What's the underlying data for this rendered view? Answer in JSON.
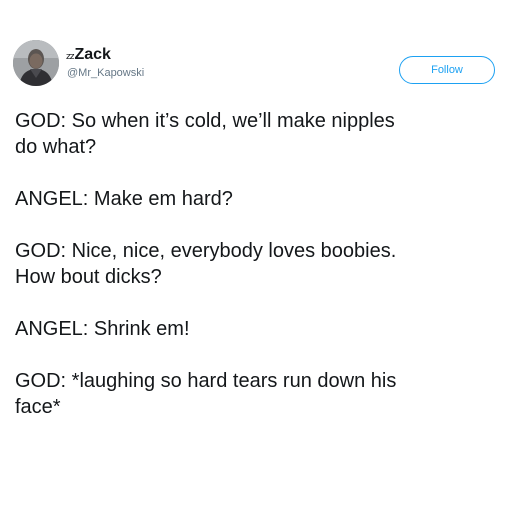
{
  "tweet": {
    "author": {
      "sleep_glyph": "zz",
      "display_name": "Zack",
      "handle": "@Mr_Kapowski",
      "avatar_icon": "user-photo-avatar"
    },
    "follow_label": "Follow",
    "paragraphs": [
      "GOD: So when it’s cold, we’ll make nipples\ndo what?",
      "ANGEL: Make em hard?",
      "GOD: Nice, nice, everybody loves boobies.\nHow bout dicks?",
      "ANGEL: Shrink em!",
      "GOD: *laughing so hard tears run down his\nface*"
    ]
  },
  "colors": {
    "text": "#14171a",
    "secondary": "#657786",
    "accent": "#1da1f2",
    "background": "#ffffff"
  }
}
